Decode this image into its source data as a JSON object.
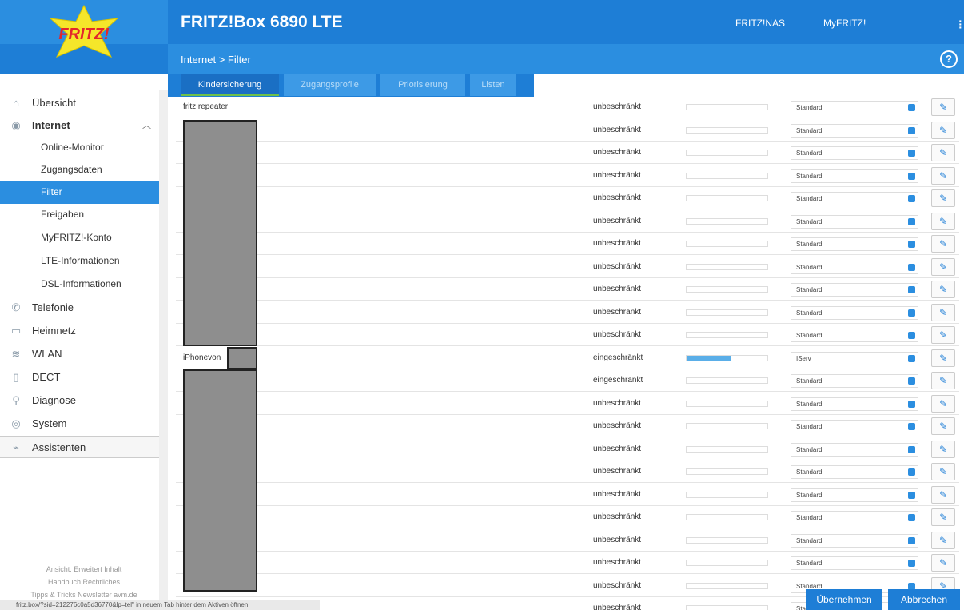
{
  "app": {
    "device_title": "FRITZ!Box 6890 LTE",
    "logo_text": "FRITZ!",
    "top_links": [
      "FRITZ!NAS",
      "MyFRITZ!"
    ],
    "breadcrumb": "Internet > Filter",
    "help": "?"
  },
  "tabs": [
    "Kindersicherung",
    "Zugangsprofile",
    "Priorisierung",
    "Listen"
  ],
  "sidebar": {
    "items": [
      {
        "label": "Übersicht",
        "icon": "home-icon"
      },
      {
        "label": "Internet",
        "icon": "globe-icon"
      },
      {
        "label": "Online-Monitor"
      },
      {
        "label": "Zugangsdaten"
      },
      {
        "label": "Filter"
      },
      {
        "label": "Freigaben"
      },
      {
        "label": "MyFRITZ!-Konto"
      },
      {
        "label": "LTE-Informationen"
      },
      {
        "label": "DSL-Informationen"
      },
      {
        "label": "Telefonie",
        "icon": "phone-icon"
      },
      {
        "label": "Heimnetz",
        "icon": "network-icon"
      },
      {
        "label": "WLAN",
        "icon": "wifi-icon"
      },
      {
        "label": "DECT",
        "icon": "dect-icon"
      },
      {
        "label": "Diagnose",
        "icon": "diagnose-icon"
      },
      {
        "label": "System",
        "icon": "system-icon"
      },
      {
        "label": "Assistenten",
        "icon": "wizard-icon"
      }
    ],
    "footer": {
      "line1": "Ansicht: Erweitert   Inhalt",
      "line2": "Handbuch   Rechtliches",
      "line3": "Tipps & Tricks   Newsletter   avm.de"
    }
  },
  "status_url": "fritz.box/?sid=212276c0a5d36770&lp=tel\" in neuem Tab hinter dem Aktiven öffnen",
  "rows": [
    {
      "name": "fritz.repeater",
      "status": "unbeschränkt",
      "profile": "Standard",
      "usage": 0
    },
    {
      "name": "",
      "status": "unbeschränkt",
      "profile": "Standard",
      "usage": 0
    },
    {
      "name": "",
      "status": "unbeschränkt",
      "profile": "Standard",
      "usage": 0
    },
    {
      "name": "",
      "status": "unbeschränkt",
      "profile": "Standard",
      "usage": 0
    },
    {
      "name": "",
      "status": "unbeschränkt",
      "profile": "Standard",
      "usage": 0
    },
    {
      "name": "",
      "status": "unbeschränkt",
      "profile": "Standard",
      "usage": 0
    },
    {
      "name": "",
      "status": "unbeschränkt",
      "profile": "Standard",
      "usage": 0
    },
    {
      "name": "",
      "status": "unbeschränkt",
      "profile": "Standard",
      "usage": 0
    },
    {
      "name": "",
      "status": "unbeschränkt",
      "profile": "Standard",
      "usage": 0
    },
    {
      "name": "",
      "status": "unbeschränkt",
      "profile": "Standard",
      "usage": 0
    },
    {
      "name": "",
      "status": "unbeschränkt",
      "profile": "Standard",
      "usage": 0
    },
    {
      "name": "iPhonevon",
      "status": "eingeschränkt",
      "profile": "IServ",
      "usage": 0.55
    },
    {
      "name": "",
      "status": "eingeschränkt",
      "profile": "Standard",
      "usage": 0
    },
    {
      "name": "",
      "status": "unbeschränkt",
      "profile": "Standard",
      "usage": 0
    },
    {
      "name": "",
      "status": "unbeschränkt",
      "profile": "Standard",
      "usage": 0
    },
    {
      "name": "",
      "status": "unbeschränkt",
      "profile": "Standard",
      "usage": 0
    },
    {
      "name": "",
      "status": "unbeschränkt",
      "profile": "Standard",
      "usage": 0
    },
    {
      "name": "",
      "status": "unbeschränkt",
      "profile": "Standard",
      "usage": 0
    },
    {
      "name": "",
      "status": "unbeschränkt",
      "profile": "Standard",
      "usage": 0
    },
    {
      "name": "",
      "status": "unbeschränkt",
      "profile": "Standard",
      "usage": 0
    },
    {
      "name": "",
      "status": "unbeschränkt",
      "profile": "Standard",
      "usage": 0
    },
    {
      "name": "",
      "status": "unbeschränkt",
      "profile": "Standard",
      "usage": 0
    },
    {
      "name": "",
      "status": "unbeschränkt",
      "profile": "Standard",
      "usage": 0
    }
  ],
  "buttons": {
    "apply": "Übernehmen",
    "cancel": "Abbrechen"
  },
  "colors": {
    "primary": "#1e7ed6",
    "active_tab_underline": "#6ec14a"
  }
}
